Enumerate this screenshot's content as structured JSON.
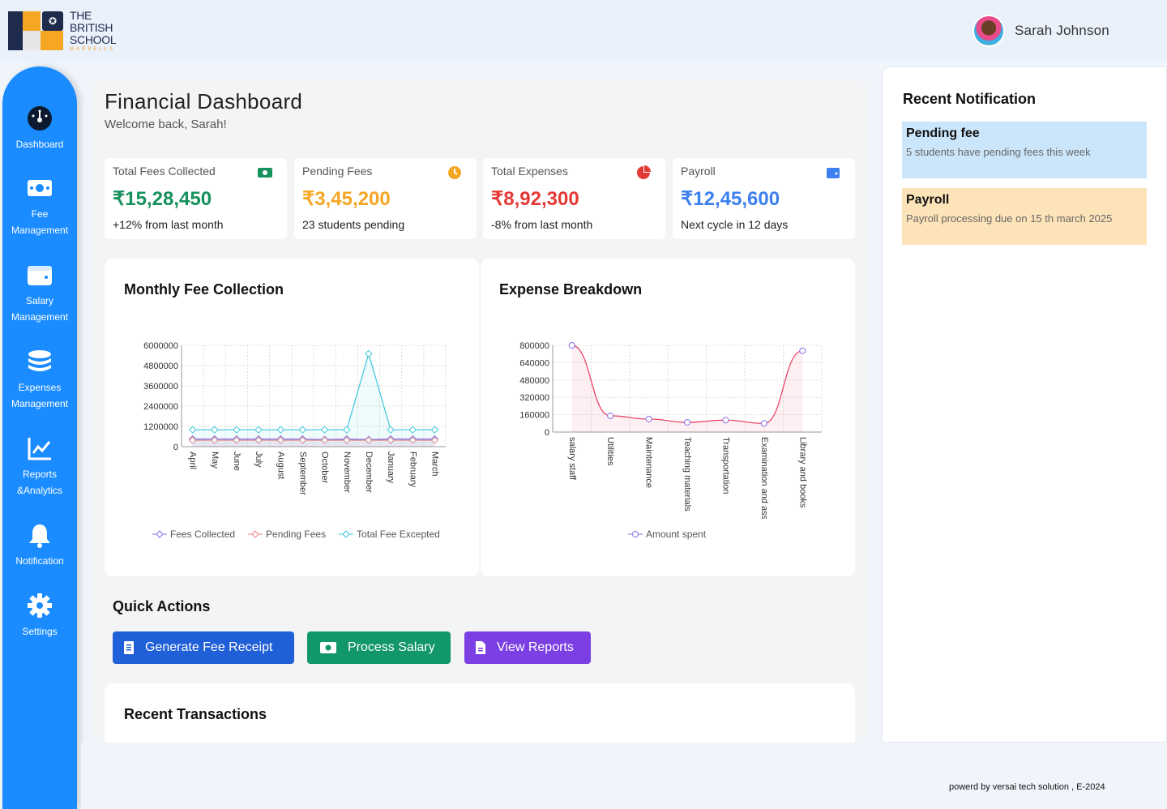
{
  "header": {
    "logo": {
      "line1": "THE",
      "line2": "BRITISH",
      "line3": "SCHOOL",
      "line4": "MARBELLA"
    },
    "user_name": "Sarah Johnson"
  },
  "sidebar": {
    "items": [
      {
        "label": "Dashboard",
        "icon": "dashboard-gauge-icon"
      },
      {
        "label": "Fee Management",
        "icon": "money-bill-icon"
      },
      {
        "label": "Salary Management",
        "icon": "wallet-icon"
      },
      {
        "label": "Expenses Management",
        "icon": "coins-stack-icon"
      },
      {
        "label": "Reports &Analytics",
        "icon": "line-chart-icon"
      },
      {
        "label": "Notification",
        "icon": "bell-icon"
      },
      {
        "label": "Settings",
        "icon": "gear-icon"
      }
    ]
  },
  "main": {
    "title": "Financial Dashboard",
    "welcome": "Welcome back, Sarah!"
  },
  "cards": [
    {
      "label": "Total Fees Collected",
      "value": "₹15,28,450",
      "note": "+12% from last month",
      "color": "#16915c",
      "icon": "money-bill-icon"
    },
    {
      "label": "Pending Fees",
      "value": "₹3,45,200",
      "note": "23 students pending",
      "color": "#f5a623",
      "icon": "clock-icon"
    },
    {
      "label": "Total Expenses",
      "value": "₹8,92,300",
      "note": "-8% from last month",
      "color": "#e53935",
      "icon": "pie-chart-icon"
    },
    {
      "label": "Payroll",
      "value": "₹12,45,600",
      "note": "Next cycle in 12 days",
      "color": "#3b7ff0",
      "icon": "wallet-icon"
    }
  ],
  "monthly_chart": {
    "title": "Monthly Fee Collection",
    "legend": [
      "Fees Collected",
      "Pending Fees",
      "Total Fee Excepted"
    ]
  },
  "expense_chart": {
    "title": "Expense Breakdown",
    "legend": [
      "Amount spent"
    ]
  },
  "chart_data": [
    {
      "type": "line",
      "title": "Monthly Fee Collection",
      "categories": [
        "April",
        "May",
        "June",
        "July",
        "August",
        "September",
        "October",
        "November",
        "December",
        "January",
        "February",
        "March"
      ],
      "ylim": [
        0,
        6000000
      ],
      "yticks": [
        0,
        1200000,
        2400000,
        3600000,
        4800000,
        6000000
      ],
      "series": [
        {
          "name": "Fees Collected",
          "color": "#8a6fe8",
          "values": [
            450000,
            450000,
            450000,
            450000,
            450000,
            450000,
            420000,
            450000,
            420000,
            450000,
            450000,
            450000
          ]
        },
        {
          "name": "Pending Fees",
          "color": "#f08080",
          "values": [
            380000,
            380000,
            380000,
            380000,
            380000,
            380000,
            380000,
            380000,
            380000,
            380000,
            380000,
            380000
          ]
        },
        {
          "name": "Total Fee Excepted",
          "color": "#3cc6dc",
          "values": [
            1000000,
            1000000,
            1000000,
            1000000,
            1000000,
            1000000,
            1000000,
            1000000,
            5500000,
            1000000,
            1000000,
            1000000
          ]
        }
      ],
      "grid": true,
      "legend_position": "bottom"
    },
    {
      "type": "line",
      "title": "Expense Breakdown",
      "categories": [
        "salary staff",
        "Utilities",
        "Maintenance",
        "Teaching materials",
        "Transportation",
        "Examination and assessment",
        "Library and books"
      ],
      "ylim": [
        0,
        800000
      ],
      "yticks": [
        0,
        160000,
        320000,
        480000,
        640000,
        800000
      ],
      "series": [
        {
          "name": "Amount spent",
          "color": "#e8385f",
          "values": [
            800000,
            150000,
            120000,
            90000,
            110000,
            80000,
            750000
          ]
        }
      ],
      "grid": true,
      "legend_position": "bottom"
    }
  ],
  "quick_actions": {
    "title": "Quick Actions",
    "buttons": [
      {
        "label": "Generate Fee Receipt",
        "color": "#1f5fd8",
        "icon": "receipt-icon"
      },
      {
        "label": "Process Salary",
        "color": "#12976a",
        "icon": "money-bill-icon"
      },
      {
        "label": "View Reports",
        "color": "#7b3fe4",
        "icon": "document-icon"
      }
    ]
  },
  "transactions": {
    "title": "Recent Transactions"
  },
  "notifications": {
    "title": "Recent Notification",
    "items": [
      {
        "title": "Pending fee",
        "text": "5 students have pending fees this week",
        "bg": "#cbe6fb"
      },
      {
        "title": "Payroll",
        "text": "Payroll processing due on 15 th march 2025",
        "bg": "#fde3b8"
      }
    ]
  },
  "footer": {
    "text": "powerd by versai tech solution , E-2024"
  }
}
